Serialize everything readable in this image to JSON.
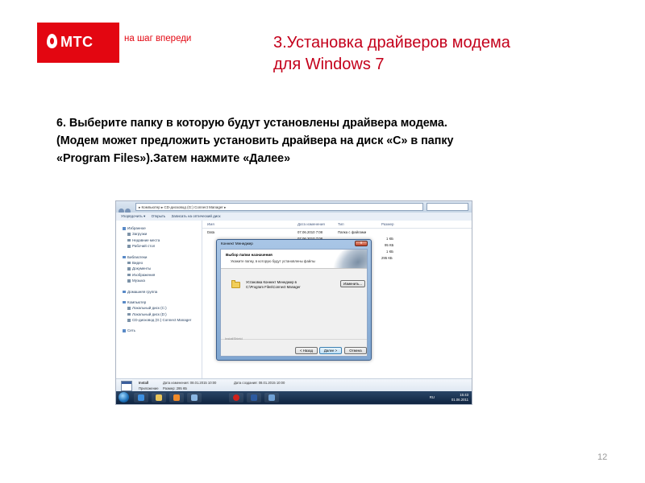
{
  "header": {
    "brand": "МТС",
    "tagline": "на шаг впереди",
    "title_line1": "3.Установка драйверов модема",
    "title_line2": "для Windows 7"
  },
  "instruction": {
    "line1": "6. Выберите папку в которую будут установлены драйвера модема.",
    "line2": "(Модем может предложить установить драйвера на диск «С» в папку",
    "line3": "«Program Files»).Затем нажмите «Далее»"
  },
  "screenshot": {
    "address_bar": "▸ Компьютер ▸ CD-дисковод (G:) Connect Manager ▸",
    "command_bar": [
      "Упорядочить ▾",
      "Открыть",
      "Записать на оптический диск"
    ],
    "nav_pane": {
      "favorites": "Избранное",
      "favorites_items": [
        "Загрузки",
        "Недавние места",
        "Рабочий стол"
      ],
      "libraries": "Библиотеки",
      "libraries_items": [
        "Видео",
        "Документы",
        "Изображения",
        "Музыка"
      ],
      "homegroup": "Домашняя группа",
      "computer": "Компьютер",
      "computer_items": [
        "Локальный диск (C:)",
        "Локальный диск (D:)",
        "CD-дисковод (G:) Connect Manager"
      ],
      "network": "Сеть"
    },
    "columns": [
      "Имя",
      "Дата изменения",
      "Тип",
      "Размер"
    ],
    "files": [
      {
        "name": "Data",
        "date": "07.06.2010 7:08",
        "type": "Папка с файлами",
        "size": ""
      },
      {
        "name": "",
        "date": "07.06.2010 7:08",
        "type": "",
        "size": "1 КБ"
      },
      {
        "name": "",
        "date": "",
        "type": "",
        "size": "95 КБ"
      },
      {
        "name": "",
        "date": "",
        "type": "",
        "size": "1 КБ"
      },
      {
        "name": "",
        "date": "",
        "type": "",
        "size": "295 КБ"
      }
    ],
    "details": {
      "name": "Install",
      "kind": "Приложение",
      "modified_label": "Дата изменения: 08.01.2015 10:00",
      "size_label": "Размер: 295 КБ",
      "created_label": "Дата создания: 08.01.2015 10:00"
    },
    "tray": {
      "lang": "RU",
      "time": "15:43",
      "date": "01.06.2011"
    },
    "dialog": {
      "window_title": "Коннект Менеджер",
      "close": "x",
      "heading": "Выбор папки назначения",
      "subheading": "Укажите папку, в которую будут установлены файлы",
      "install_text": "Установка Коннект Менеджер в",
      "install_path": "C:\\Program Files\\Connect Manager",
      "change_button": "Изменить...",
      "footer_brand": "InstallShield",
      "back_button": "< Назад",
      "next_button": "Далее >",
      "cancel_button": "Отмена"
    }
  },
  "page_number": "12"
}
